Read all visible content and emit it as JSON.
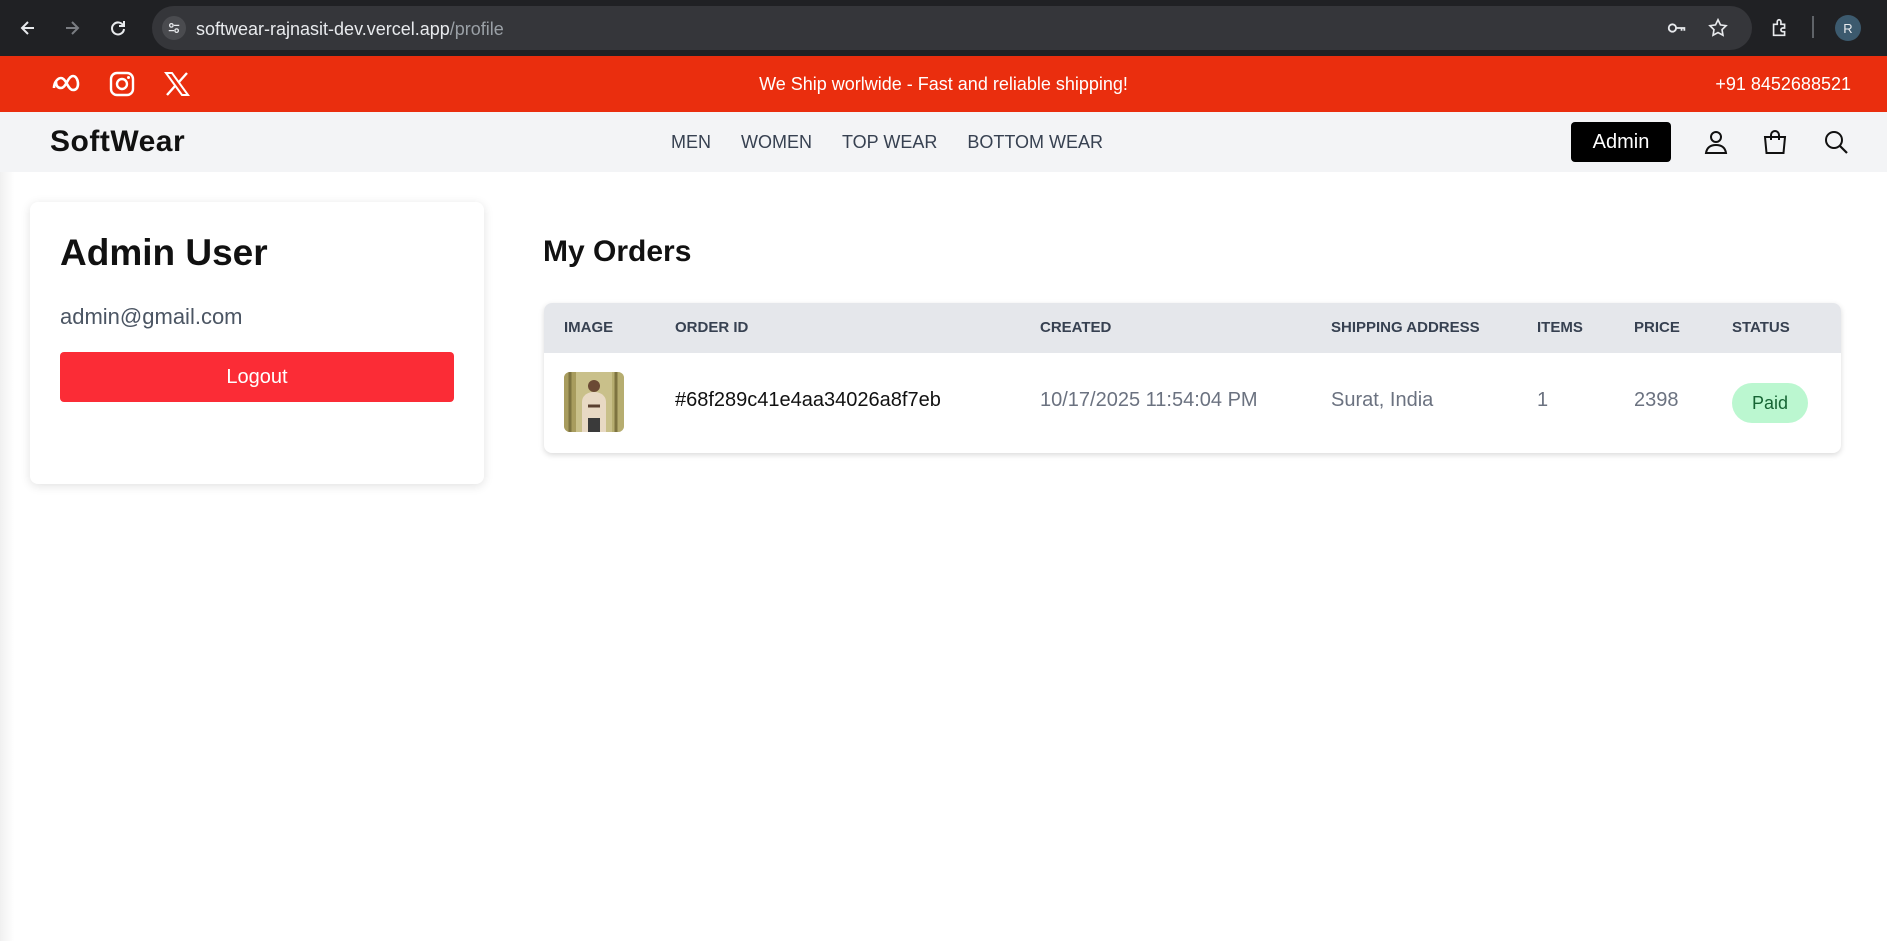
{
  "browser": {
    "url_host": "softwear-rajnasit-dev.vercel.app",
    "url_path": "/profile",
    "profile_initial": "R"
  },
  "promo": {
    "message": "We Ship worlwide - Fast and reliable shipping!",
    "phone": "+91 8452688521",
    "color": "#ea2e0e"
  },
  "header": {
    "logo": "SoftWear",
    "nav": [
      "MEN",
      "WOMEN",
      "TOP WEAR",
      "BOTTOM WEAR"
    ],
    "admin_label": "Admin"
  },
  "profile": {
    "name": "Admin User",
    "email": "admin@gmail.com",
    "logout_label": "Logout"
  },
  "orders": {
    "title": "My Orders",
    "columns": [
      "IMAGE",
      "ORDER ID",
      "CREATED",
      "SHIPPING ADDRESS",
      "ITEMS",
      "PRICE",
      "STATUS"
    ],
    "rows": [
      {
        "order_id": "#68f289c41e4aa34026a8f7eb",
        "created": "10/17/2025 11:54:04 PM",
        "address": "Surat, India",
        "items": "1",
        "price": "2398",
        "status": "Paid"
      }
    ]
  }
}
